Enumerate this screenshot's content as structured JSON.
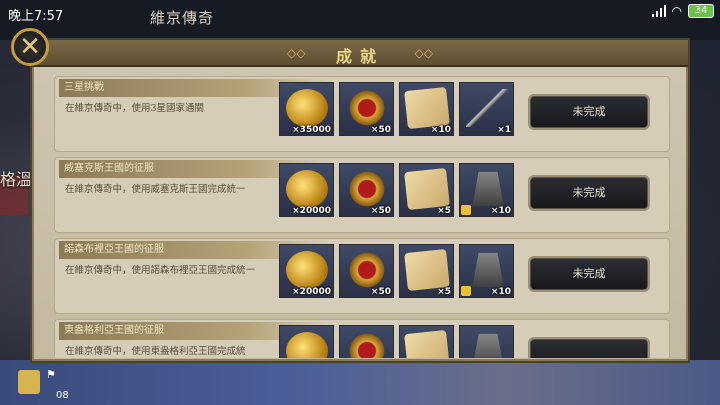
{
  "status_bar": {
    "time": "晚上7:57",
    "battery": "34"
  },
  "map": {
    "title": "維京傳奇",
    "left_label": "格溫"
  },
  "panel": {
    "title": "成就"
  },
  "achievements": [
    {
      "title": "三星挑戰",
      "description": "在維京傳奇中，使用3星國家通關",
      "rewards": [
        {
          "type": "gold",
          "qty": "×35000"
        },
        {
          "type": "medal",
          "qty": "×50"
        },
        {
          "type": "scroll",
          "qty": "×10"
        },
        {
          "type": "spear",
          "qty": "×1"
        }
      ],
      "status": "未完成"
    },
    {
      "title": "威塞克斯王國的征服",
      "description": "在維京傳奇中，使用威塞克斯王國完成統一",
      "rewards": [
        {
          "type": "gold",
          "qty": "×20000"
        },
        {
          "type": "medal",
          "qty": "×50"
        },
        {
          "type": "scroll",
          "qty": "×5"
        },
        {
          "type": "siege",
          "qty": "×10"
        }
      ],
      "status": "未完成"
    },
    {
      "title": "諾森布裡亞王國的征服",
      "description": "在維京傳奇中，使用諾森布裡亞王國完成統一",
      "rewards": [
        {
          "type": "gold",
          "qty": "×20000"
        },
        {
          "type": "medal",
          "qty": "×50"
        },
        {
          "type": "scroll",
          "qty": "×5"
        },
        {
          "type": "siege",
          "qty": "×10"
        }
      ],
      "status": "未完成"
    },
    {
      "title": "東盎格利亞王國的征服",
      "description": "在維京傳奇中，使用東盎格利亞王國完成統",
      "rewards": [
        {
          "type": "gold",
          "qty": ""
        },
        {
          "type": "medal",
          "qty": ""
        },
        {
          "type": "scroll",
          "qty": ""
        },
        {
          "type": "siege",
          "qty": ""
        }
      ],
      "status": ""
    }
  ],
  "bottom": {
    "turn": "08"
  }
}
